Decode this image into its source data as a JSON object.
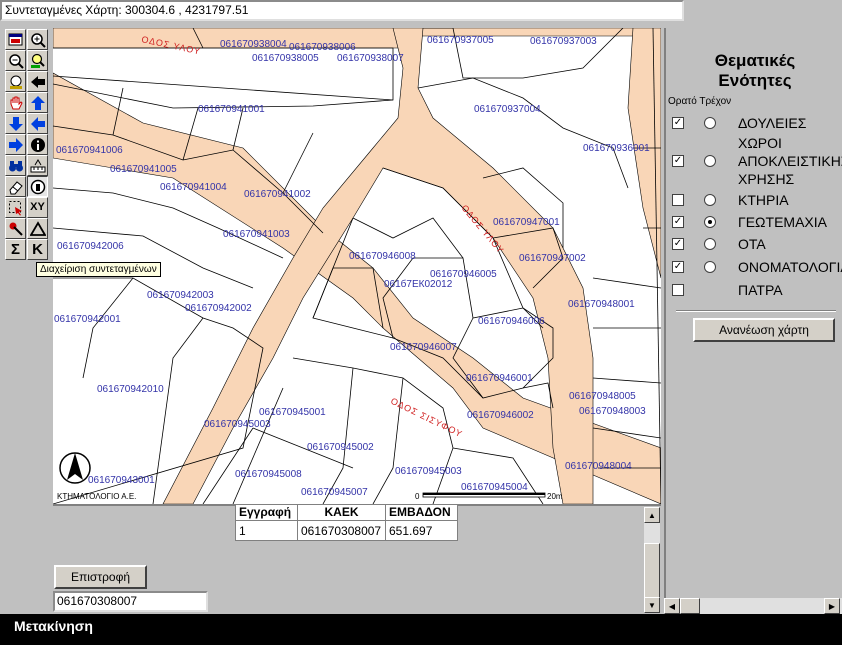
{
  "coords": {
    "text": "Συντεταγμένες Χάρτη: 300304.6 , 4231797.51"
  },
  "toolbar": {
    "tooltip": "Διαχείριση συντεταγμένων",
    "buttons": [
      {
        "icon": "full-extent-icon"
      },
      {
        "icon": "zoom-in-icon"
      },
      {
        "icon": "zoom-out-icon"
      },
      {
        "icon": "zoom-previous-icon"
      },
      {
        "icon": "find-icon"
      },
      {
        "icon": "back-arrow-icon"
      },
      {
        "icon": "pan-hand-icon"
      },
      {
        "icon": "pan-up-icon"
      },
      {
        "icon": "pan-down-icon"
      },
      {
        "icon": "pan-left-icon"
      },
      {
        "icon": "pan-right-icon"
      },
      {
        "icon": "info-icon"
      },
      {
        "icon": "binoculars-icon"
      },
      {
        "icon": "measure-icon"
      },
      {
        "icon": "eraser-icon"
      },
      {
        "icon": "identify-icon"
      },
      {
        "icon": "select-box-icon"
      },
      {
        "icon": "xy-coordinates-icon",
        "label": "XY"
      },
      {
        "icon": "select-pointer-icon"
      },
      {
        "icon": "triangle-icon",
        "label": "Δ"
      },
      {
        "icon": "sum-icon",
        "label": "Σ"
      },
      {
        "icon": "k-icon",
        "label": "K"
      }
    ]
  },
  "map": {
    "streets": [
      "ΟΔΟΣ ΥΛΟΥ",
      "ΟΔΟΣ ΥΛΟΥ",
      "ΟΔΟΣ ΣΙΣΥΦΟΥ"
    ],
    "credit": "ΚΤΗΜΑΤΟΛΟΓΙΟ Α.Ε.",
    "scale_label": "0",
    "scale_end": "20m",
    "road_color": "#f9d6b7",
    "label_color": "#3333a8",
    "street_color": "#d02020",
    "parcels": [
      "061670938004",
      "061670938006",
      "061670938005",
      "061670938007",
      "061670937005",
      "061670937003",
      "061670941001",
      "061670937004",
      "061670941006",
      "061670941005",
      "061670941004",
      "061670941002",
      "061670936001",
      "061670941003",
      "061670947001",
      "061670942006",
      "061670946008",
      "061670946005",
      "061670947002",
      "061670942003",
      "061670942002",
      "061670948001",
      "061670942001",
      "061670946006",
      "061670946007",
      "061670946001",
      "061670942010",
      "061670948005",
      "061670945001",
      "061670948003",
      "061670946002",
      "061670945003",
      "061670945002",
      "061670948004",
      "061670945008",
      "061670945007",
      "061670943001",
      "061670945004",
      "061670945003"
    ],
    "special_parcel": "061б7ЕК02012"
  },
  "results": {
    "headers": [
      "Εγγραφή",
      "ΚΑΕΚ",
      "ΕΜΒΑΔΟΝ"
    ],
    "rows": [
      [
        "1",
        "061670308007",
        "651.697"
      ]
    ]
  },
  "back_button": "Επιστροφή",
  "search_value": "061670308007",
  "side": {
    "title_line1": "Θεματικές",
    "title_line2": "Ενότητες",
    "col_visible": "Ορατό",
    "col_current": "Τρέχον",
    "layers": [
      {
        "name": "ΔΟΥΛΕΙΕΣ",
        "visible": true,
        "current": false
      },
      {
        "name_lines": [
          "ΧΩΡΟΙ",
          "ΑΠΟΚΛΕΙΣΤΙΚΗΣ",
          "ΧΡΗΣΗΣ"
        ],
        "visible": true,
        "current": false
      },
      {
        "name": "ΚΤΗΡΙΑ",
        "visible": false,
        "current": false
      },
      {
        "name": "ΓΕΩΤΕΜΑΧΙΑ",
        "visible": true,
        "current": true
      },
      {
        "name": "ΟΤΑ",
        "visible": true,
        "current": false
      },
      {
        "name": "ΟΝΟΜΑΤΟΛΟΓΙΑ",
        "visible": true,
        "current": false
      },
      {
        "name": "ΠΑΤΡΑ",
        "visible": false,
        "current": null
      }
    ],
    "refresh": "Ανανέωση χάρτη"
  },
  "status": "Μετακίνηση"
}
